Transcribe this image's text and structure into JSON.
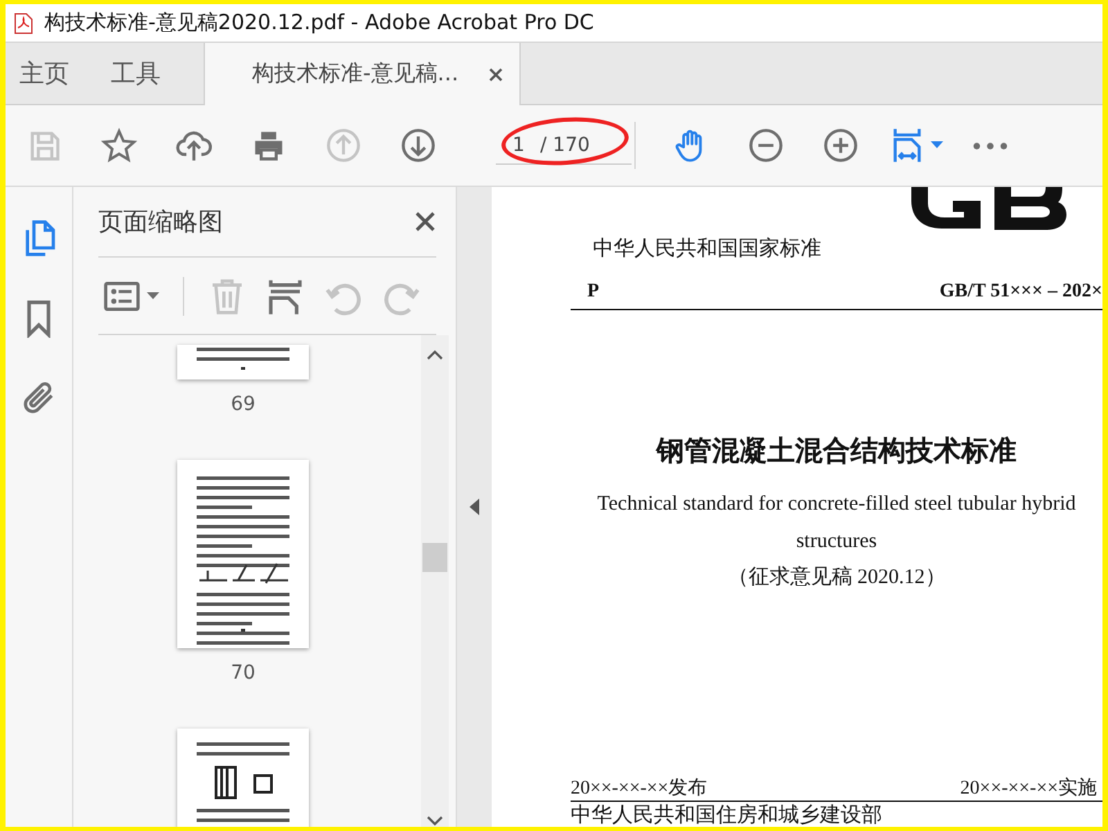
{
  "window": {
    "title": "构技术标准-意见稿2020.12.pdf - Adobe Acrobat Pro DC"
  },
  "tabs": [
    {
      "label": "主页",
      "selected": false,
      "kind": "nav"
    },
    {
      "label": "工具",
      "selected": false,
      "kind": "nav"
    },
    {
      "label": "构技术标准-意见稿...",
      "selected": true,
      "kind": "document"
    }
  ],
  "toolbar": {
    "left": [
      {
        "kind": "save",
        "disabled": true
      },
      {
        "kind": "star",
        "disabled": false
      },
      {
        "kind": "upload",
        "disabled": false
      },
      {
        "kind": "print",
        "disabled": false
      },
      {
        "kind": "page-up",
        "disabled": true
      },
      {
        "kind": "page-down",
        "disabled": false
      }
    ],
    "page_field": {
      "value": "1",
      "total": "/ 170",
      "circled": true
    },
    "right": [
      {
        "kind": "hand",
        "disabled": false
      },
      {
        "kind": "zoom-out",
        "disabled": false
      },
      {
        "kind": "zoom-in",
        "disabled": false
      },
      {
        "kind": "fit-width",
        "disabled": false
      },
      {
        "kind": "more",
        "disabled": false
      }
    ]
  },
  "side_rail": [
    {
      "kind": "pages",
      "selected": true
    },
    {
      "kind": "bookmarks",
      "selected": false
    },
    {
      "kind": "attachments",
      "selected": false
    }
  ],
  "panel": {
    "title": "页面缩略图",
    "tools": [
      {
        "kind": "options",
        "disabled": false
      },
      {
        "kind": "delete",
        "disabled": true
      },
      {
        "kind": "insert",
        "disabled": false
      },
      {
        "kind": "rotate-ccw",
        "disabled": true
      },
      {
        "kind": "rotate-cw",
        "disabled": true
      }
    ],
    "thumbnails": [
      {
        "kind": "partial-bottom",
        "label": "69"
      },
      {
        "kind": "full",
        "label": "70"
      },
      {
        "kind": "partial-top"
      }
    ]
  },
  "document": {
    "national_standard": "中华人民共和国国家标准",
    "category": "P",
    "code": "GB/T 51××× – 202×",
    "title_zh": "钢管混凝土混合结构技术标准",
    "title_en": "Technical standard for concrete-filled steel tubular hybrid structures",
    "edition": "（征求意见稿 2020.12）",
    "issued": "20××-××-××发布",
    "effective": "20××-××-××实施",
    "issuer": "中华人民共和国住房和城乡建设部"
  }
}
